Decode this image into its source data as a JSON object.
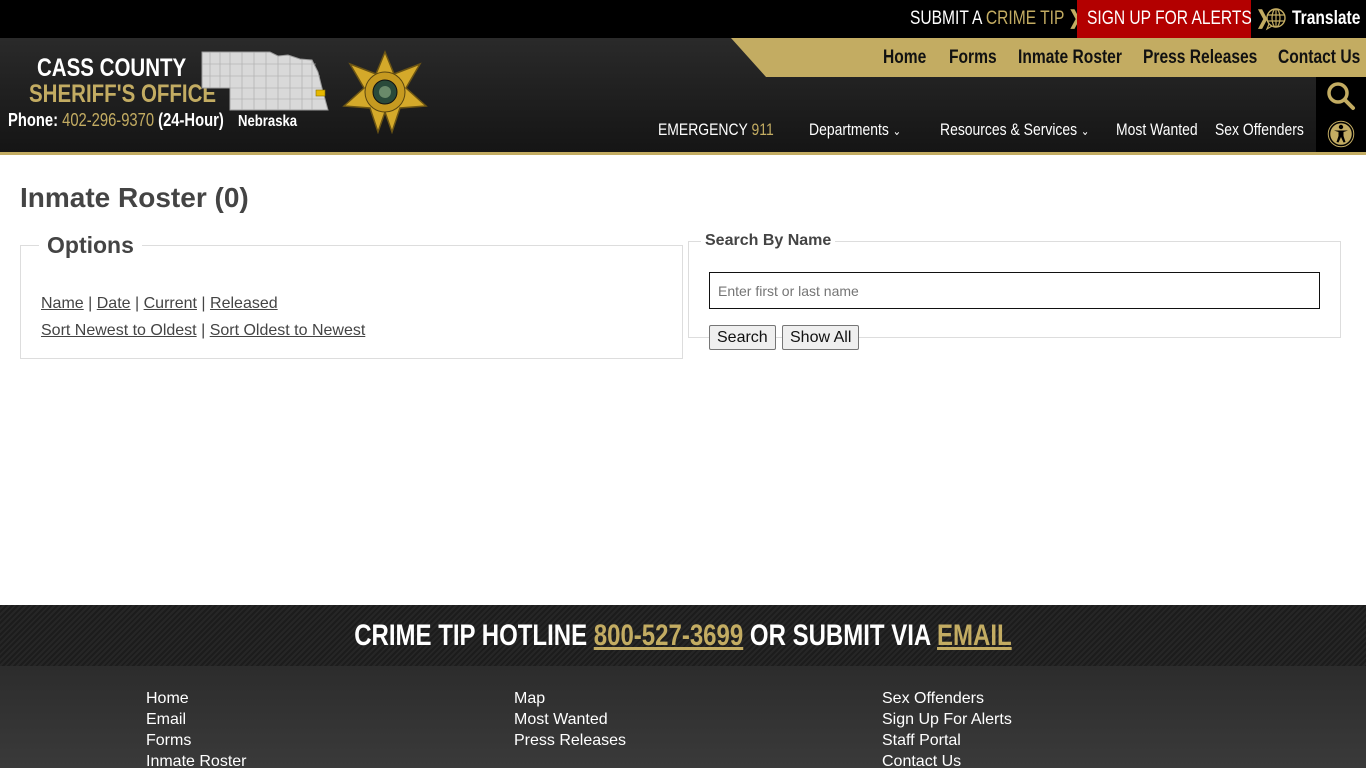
{
  "topbar": {
    "crime_tip_prefix": "SUBMIT A",
    "crime_tip_highlight": "CRIME TIP",
    "alerts_label": "SIGN UP FOR ALERTS",
    "translate_label": "Translate",
    "chevron": "›"
  },
  "brand": {
    "line1": "CASS COUNTY",
    "line2": "SHERIFF'S OFFICE",
    "phone_label": "Phone:",
    "phone_number": "402-296-9370",
    "phone_note": "(24-Hour)",
    "map_label": "Nebraska"
  },
  "goldnav": [
    "Home",
    "Forms",
    "Inmate Roster",
    "Press Releases",
    "Contact Us"
  ],
  "mainnav": {
    "emergency_label": "EMERGENCY",
    "emergency_number": "911",
    "items": [
      "Departments",
      "Resources & Services",
      "Most Wanted",
      "Sex Offenders"
    ]
  },
  "page": {
    "title": "Inmate Roster (0)"
  },
  "options": {
    "legend": "Options",
    "filters": [
      "Name",
      "Date",
      "Current",
      "Released"
    ],
    "sorts": [
      "Sort Newest to Oldest",
      "Sort Oldest to Newest"
    ],
    "separator": "|"
  },
  "search": {
    "legend": "Search By Name",
    "value": "",
    "placeholder": "Enter first or last name",
    "search_label": "Search",
    "show_all_label": "Show All"
  },
  "hotline": {
    "prefix": "CRIME TIP HOTLINE",
    "number": "800-527-3699",
    "middle": "OR SUBMIT VIA",
    "email": "EMAIL"
  },
  "footer": {
    "col1": [
      "Home",
      "Email",
      "Forms",
      "Inmate Roster"
    ],
    "col2": [
      "Map",
      "Most Wanted",
      "Press Releases"
    ],
    "col3": [
      "Sex Offenders",
      "Sign Up For Alerts",
      "Staff Portal",
      "Contact Us"
    ]
  },
  "colors": {
    "gold": "#c3ac62",
    "alert_red": "#b30000",
    "dark": "#1c1c1c"
  }
}
